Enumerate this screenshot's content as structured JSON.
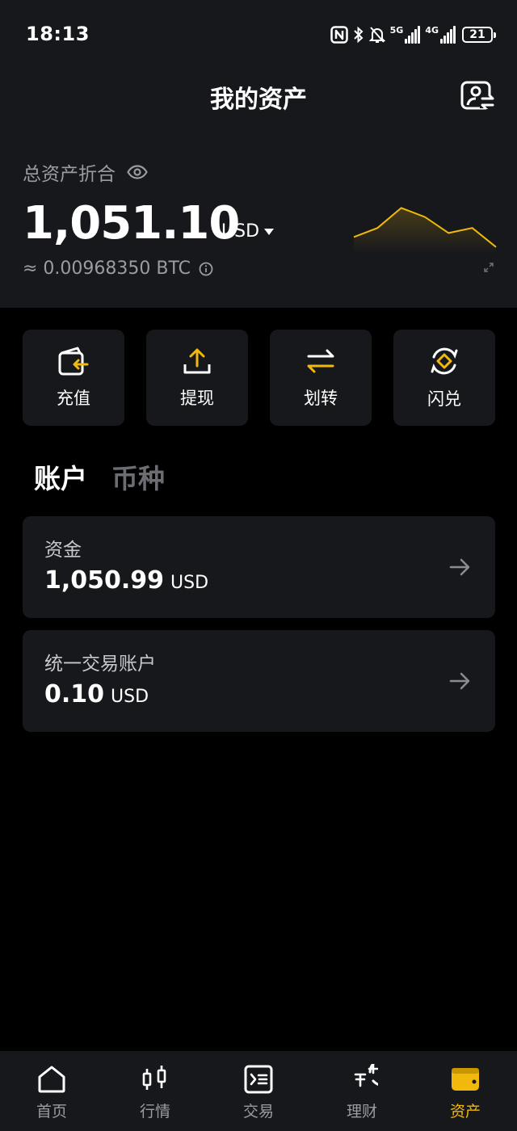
{
  "status_bar": {
    "time": "18:13",
    "network_5g": "5G",
    "network_4g": "4G",
    "battery": "21"
  },
  "header": {
    "title": "我的资产"
  },
  "balance": {
    "label": "总资产折合",
    "amount": "1,051.10",
    "currency": "USD",
    "btc_equiv": "≈ 0.00968350 BTC",
    "sparkline": [
      0.3,
      0.48,
      0.88,
      0.7,
      0.38,
      0.48,
      0.1
    ]
  },
  "actions": [
    {
      "label": "充值",
      "icon": "deposit-icon"
    },
    {
      "label": "提现",
      "icon": "withdraw-icon"
    },
    {
      "label": "划转",
      "icon": "transfer-icon"
    },
    {
      "label": "闪兑",
      "icon": "convert-icon"
    }
  ],
  "tabs": [
    {
      "label": "账户",
      "active": true
    },
    {
      "label": "币种",
      "active": false
    }
  ],
  "accounts": [
    {
      "name": "资金",
      "amount": "1,050.99",
      "currency": "USD"
    },
    {
      "name": "统一交易账户",
      "amount": "0.10",
      "currency": "USD"
    }
  ],
  "bottom_nav": [
    {
      "label": "首页",
      "icon": "home-icon"
    },
    {
      "label": "行情",
      "icon": "candlestick-icon"
    },
    {
      "label": "交易",
      "icon": "trade-icon"
    },
    {
      "label": "理财",
      "icon": "earn-icon"
    },
    {
      "label": "资产",
      "icon": "wallet-icon",
      "active": true
    }
  ],
  "colors": {
    "accent": "#f0b90b",
    "card": "#17181c",
    "background": "#000000",
    "muted": "#9a9ca3"
  }
}
